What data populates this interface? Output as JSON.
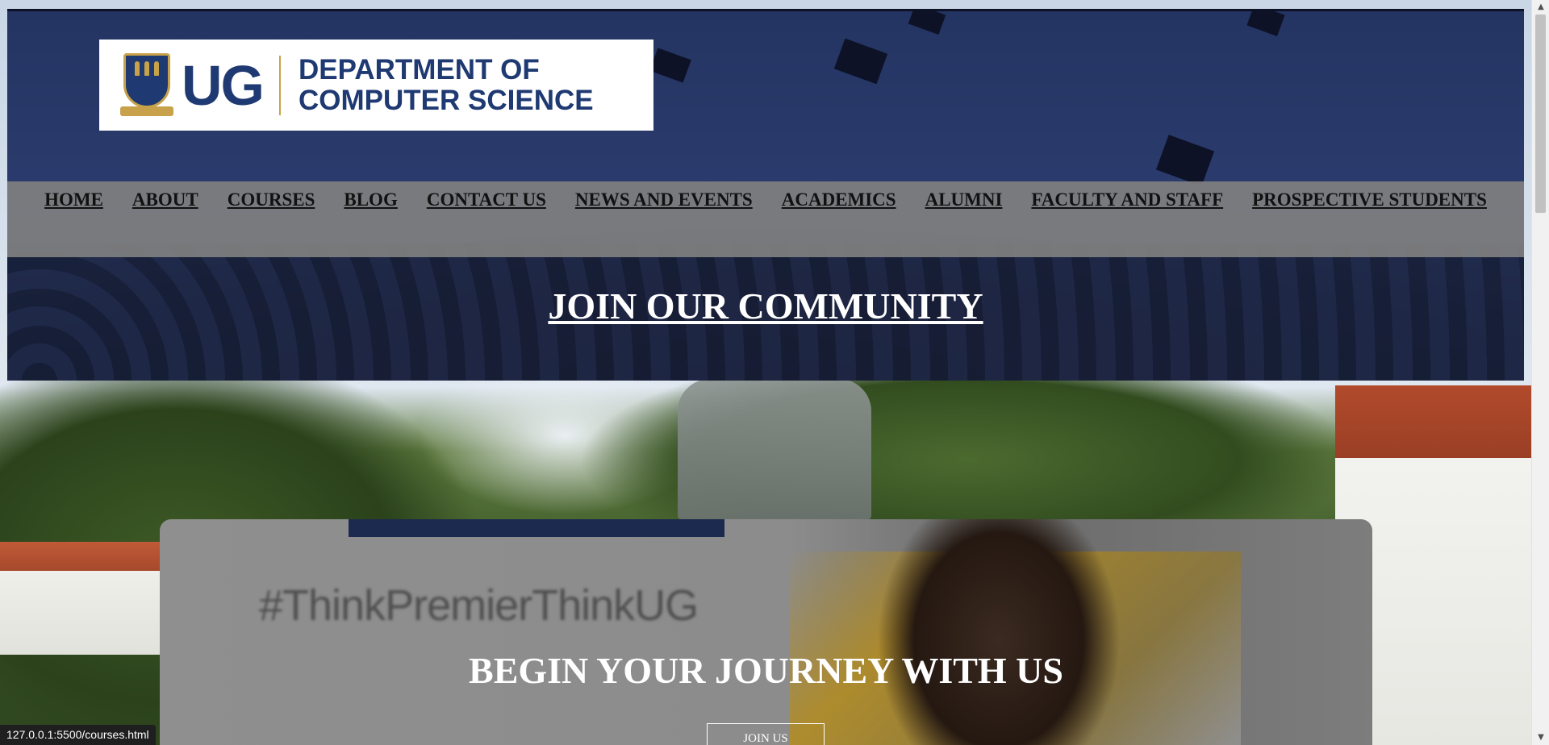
{
  "logo": {
    "short": "UG",
    "dept_line1": "DEPARTMENT OF",
    "dept_line2": "COMPUTER SCIENCE"
  },
  "nav": {
    "items": [
      "HOME",
      "ABOUT",
      "COURSES",
      "BLOG",
      "CONTACT US",
      "NEWS AND EVENTS",
      "ACADEMICS",
      "ALUMNI",
      "FACULTY AND STAFF",
      "PROSPECTIVE STUDENTS"
    ]
  },
  "hero": {
    "community_heading": "JOIN OUR COMMUNITY"
  },
  "journey": {
    "photo_text": "#ThinkPremierThinkUG",
    "heading": "BEGIN YOUR JOURNEY WITH US",
    "button_label": "JOIN US"
  },
  "statusbar": {
    "url": "127.0.0.1:5500/courses.html"
  },
  "colors": {
    "brand_navy": "#1f3a72",
    "brand_gold": "#c8a24a",
    "nav_bg": "#808080"
  }
}
